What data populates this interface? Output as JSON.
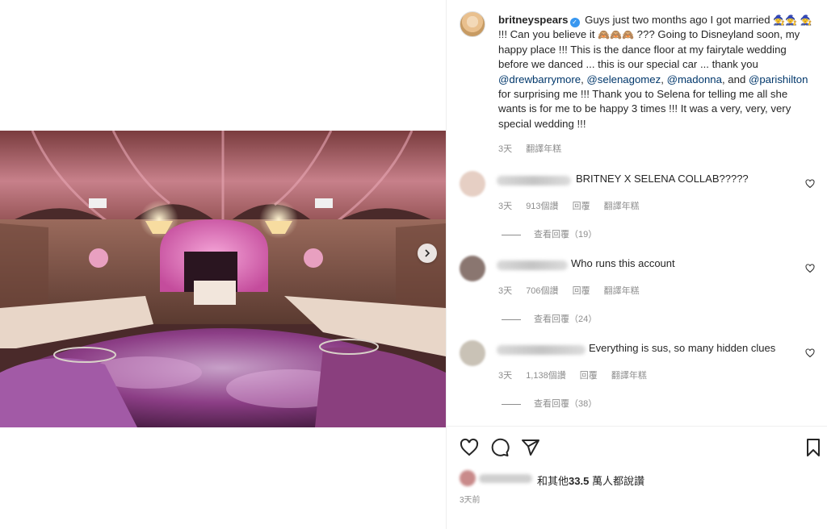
{
  "post": {
    "username": "britneyspears",
    "caption_parts": {
      "p1": " Guys just two months ago I got married ",
      "p2": " !!! Can you believe it ",
      "p3": " ??? Going to Disneyland soon, my happy place !!! This is the dance floor at my fairytale wedding before we danced ... this is our special car ... thank you ",
      "m1": "@drewbarrymore",
      "sep1": ", ",
      "m2": "@selenagomez",
      "sep2": ", ",
      "m3": "@madonna",
      "sep3": ", and ",
      "m4": "@parishilton",
      "p4": " for surprising me !!! Thank you to Selena for telling me all she wants is for me to be happy 3 times !!! It was a very, very, very special wedding !!!"
    },
    "emoji_hat": "🧙",
    "emoji_monkey": "🙈",
    "caption_time": "3天",
    "see_translation": "翻譯年糕"
  },
  "comments": [
    {
      "text": "BRITNEY X SELENA COLLAB?????",
      "time": "3天",
      "likes": "913個讚",
      "reply": "回覆",
      "translate": "翻譯年糕",
      "view_replies": "查看回覆（19）"
    },
    {
      "text": "Who runs this account",
      "time": "3天",
      "likes": "706個讚",
      "reply": "回覆",
      "translate": "翻譯年糕",
      "view_replies": "查看回覆（24）"
    },
    {
      "text": "Everything is sus, so many hidden clues",
      "time": "3天",
      "likes": "1,138個讚",
      "reply": "回覆",
      "translate": "翻譯年糕",
      "view_replies": "查看回覆（38）"
    }
  ],
  "likes": {
    "prefix": "和其他",
    "count": "33.5",
    "suffix": " 萬人都說讚"
  },
  "post_time": "3天前",
  "colors": {
    "mention": "#00376b",
    "verified": "#3897f0",
    "muted": "#8e8e8e",
    "text": "#262626"
  },
  "icons": [
    "verified-badge-icon",
    "heart-icon",
    "comment-icon",
    "share-icon",
    "bookmark-icon",
    "chevron-right-icon"
  ]
}
